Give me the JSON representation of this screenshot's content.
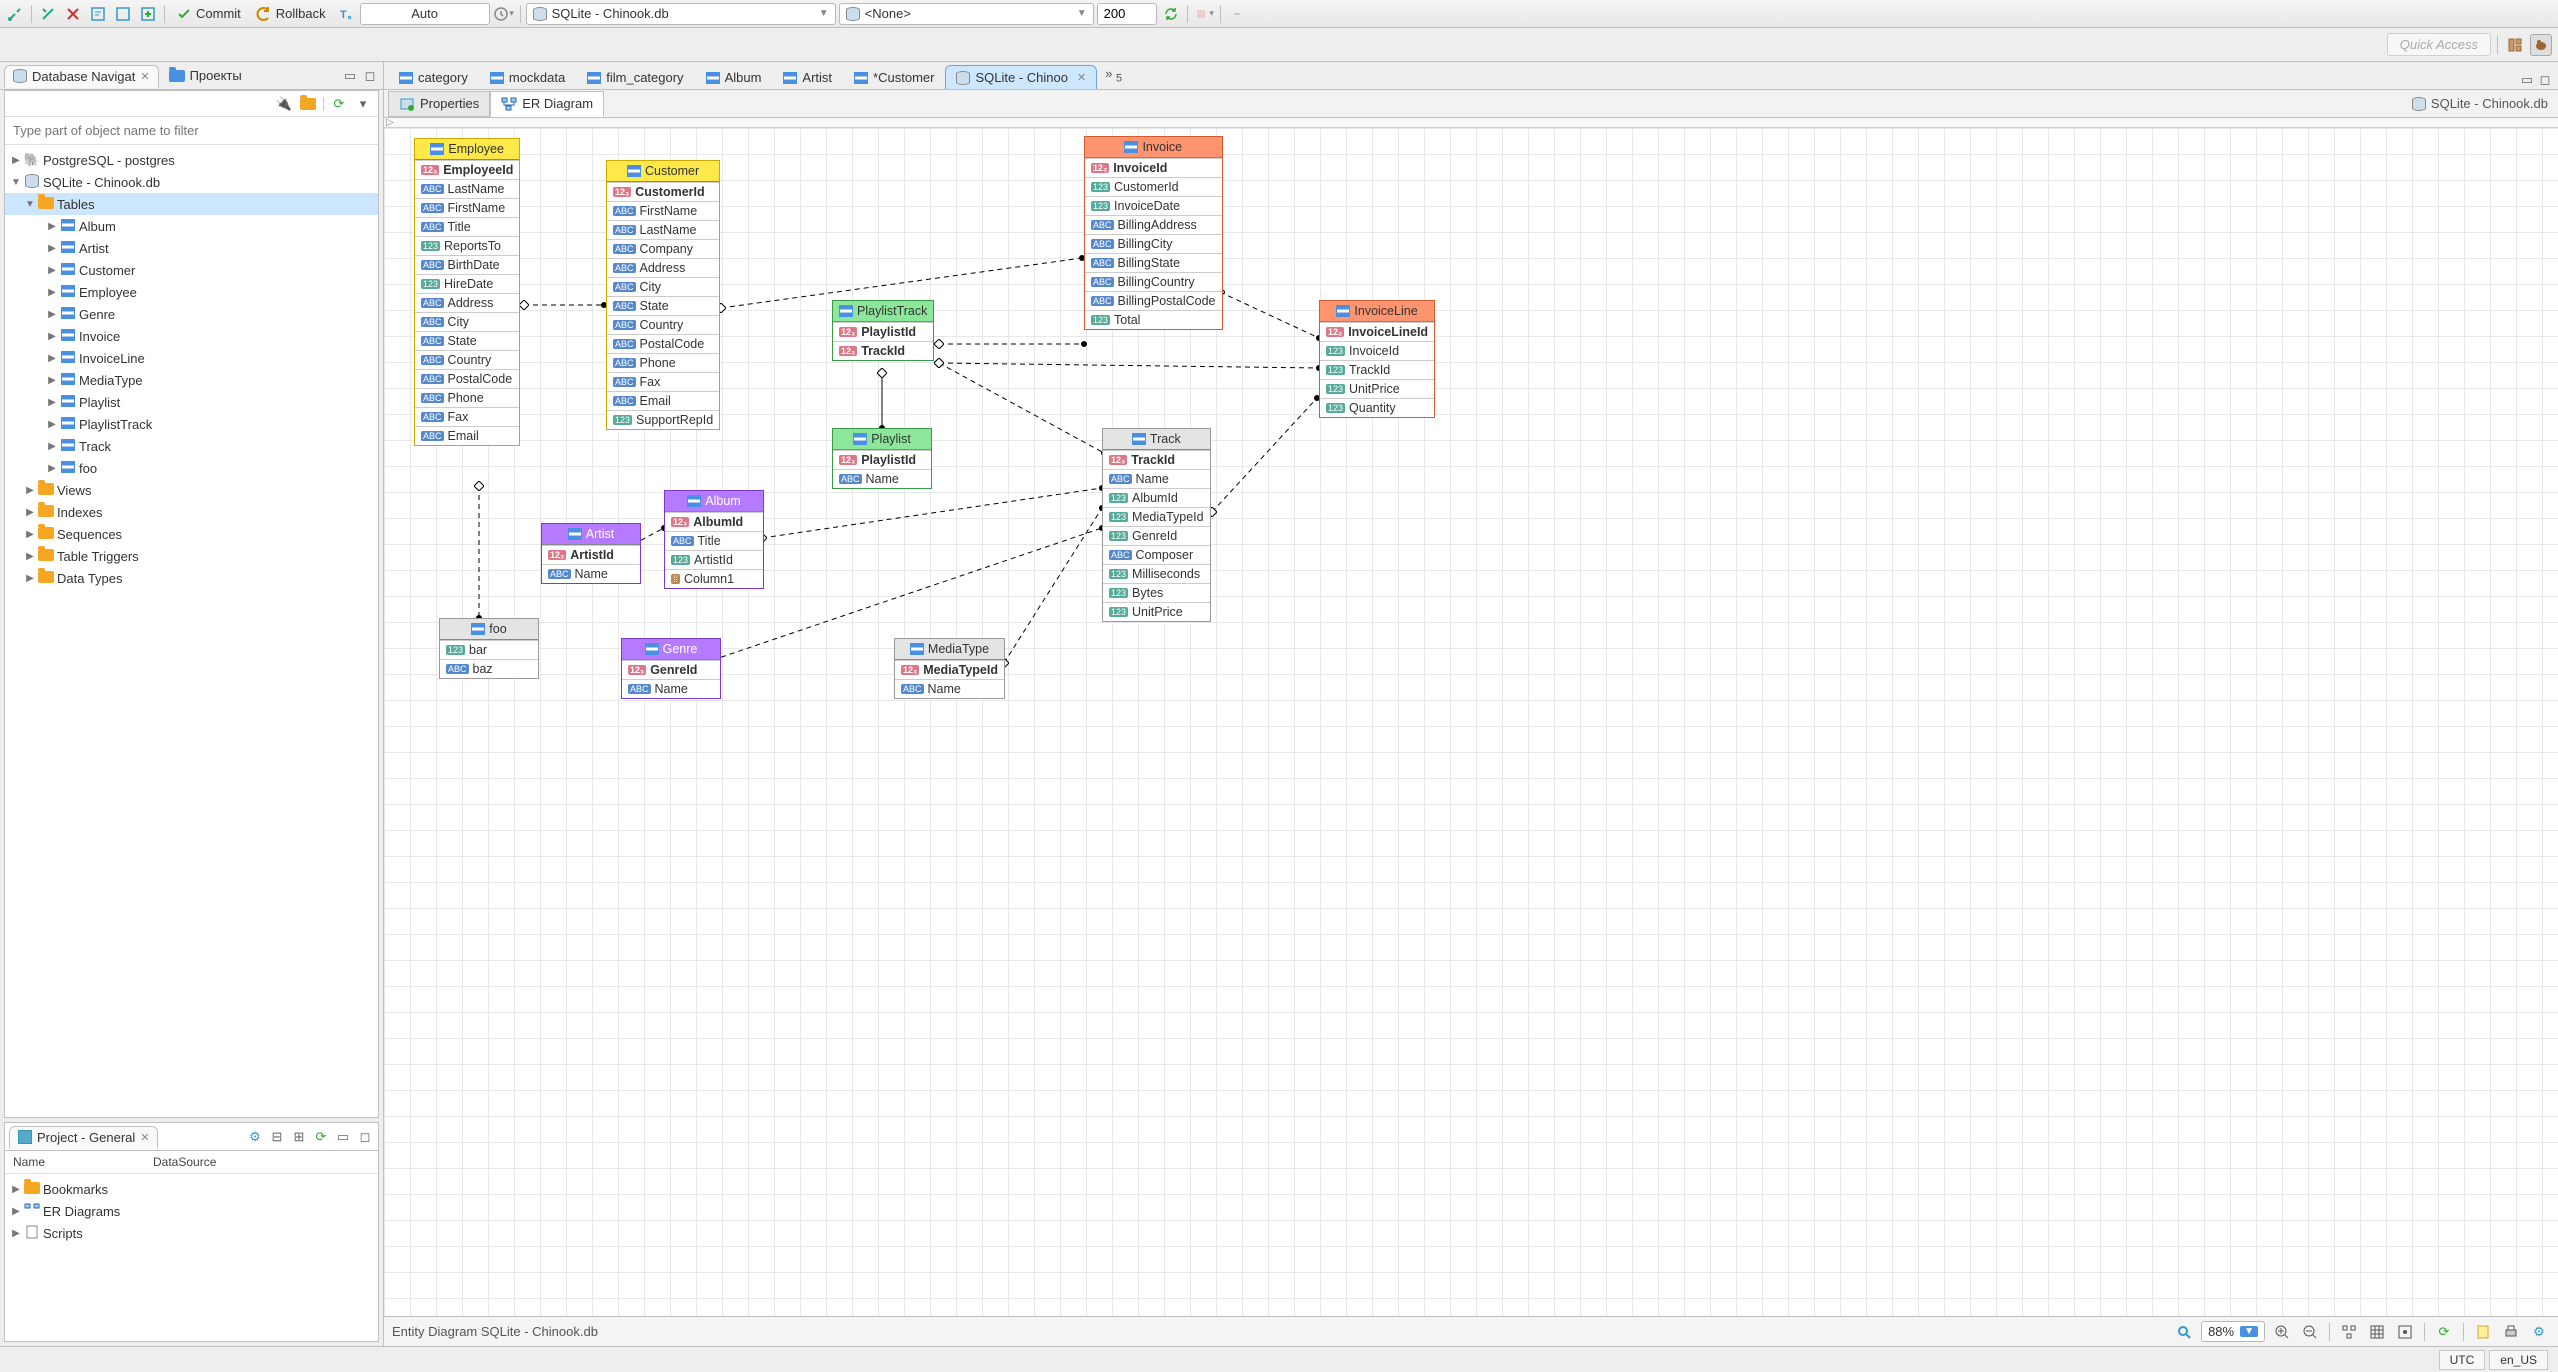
{
  "toolbar": {
    "commit": "Commit",
    "rollback": "Rollback",
    "tx_mode": "Auto",
    "active_db": "SQLite - Chinook.db",
    "active_schema": "<None>",
    "limit": "200"
  },
  "quick_access": "Quick Access",
  "nav_view": {
    "tab1": "Database Navigat",
    "tab2": "Проекты",
    "filter_placeholder": "Type part of object name to filter"
  },
  "nav_tree": {
    "postgres": "PostgreSQL - postgres",
    "sqlite": "SQLite - Chinook.db",
    "tables_label": "Tables",
    "tables": [
      "Album",
      "Artist",
      "Customer",
      "Employee",
      "Genre",
      "Invoice",
      "InvoiceLine",
      "MediaType",
      "Playlist",
      "PlaylistTrack",
      "Track",
      "foo"
    ],
    "views": "Views",
    "indexes": "Indexes",
    "sequences": "Sequences",
    "triggers": "Table Triggers",
    "datatypes": "Data Types"
  },
  "project_view": {
    "title": "Project - General",
    "col_name": "Name",
    "col_ds": "DataSource",
    "items": [
      "Bookmarks",
      "ER Diagrams",
      "Scripts"
    ]
  },
  "editor_tabs": [
    "category",
    "mockdata",
    "film_category",
    "Album",
    "Artist",
    "*Customer",
    "SQLite - Chinoo"
  ],
  "editor_tabs_overflow": "5",
  "subtabs": {
    "properties": "Properties",
    "er": "ER Diagram"
  },
  "breadcrumb": "SQLite - Chinook.db",
  "er": {
    "Employee": {
      "cols": [
        "EmployeeId",
        "LastName",
        "FirstName",
        "Title",
        "ReportsTo",
        "BirthDate",
        "HireDate",
        "Address",
        "City",
        "State",
        "Country",
        "PostalCode",
        "Phone",
        "Fax",
        "Email"
      ],
      "types": [
        "123",
        "ABC",
        "ABC",
        "ABC",
        "123",
        "ABC",
        "123",
        "ABC",
        "ABC",
        "ABC",
        "ABC",
        "ABC",
        "ABC",
        "ABC",
        "ABC"
      ],
      "pk": 0
    },
    "Customer": {
      "cols": [
        "CustomerId",
        "FirstName",
        "LastName",
        "Company",
        "Address",
        "City",
        "State",
        "Country",
        "PostalCode",
        "Phone",
        "Fax",
        "Email",
        "SupportRepId"
      ],
      "types": [
        "123",
        "ABC",
        "ABC",
        "ABC",
        "ABC",
        "ABC",
        "ABC",
        "ABC",
        "ABC",
        "ABC",
        "ABC",
        "ABC",
        "123"
      ],
      "pk": 0
    },
    "Invoice": {
      "cols": [
        "InvoiceId",
        "CustomerId",
        "InvoiceDate",
        "BillingAddress",
        "BillingCity",
        "BillingState",
        "BillingCountry",
        "BillingPostalCode",
        "Total"
      ],
      "types": [
        "123",
        "123",
        "123",
        "ABC",
        "ABC",
        "ABC",
        "ABC",
        "ABC",
        "123"
      ],
      "pk": 0
    },
    "InvoiceLine": {
      "cols": [
        "InvoiceLineId",
        "InvoiceId",
        "TrackId",
        "UnitPrice",
        "Quantity"
      ],
      "types": [
        "123",
        "123",
        "123",
        "123",
        "123"
      ],
      "pk": 0
    },
    "PlaylistTrack": {
      "cols": [
        "PlaylistId",
        "TrackId"
      ],
      "types": [
        "123",
        "123"
      ],
      "pk": -1
    },
    "Playlist": {
      "cols": [
        "PlaylistId",
        "Name"
      ],
      "types": [
        "123",
        "ABC"
      ],
      "pk": 0
    },
    "Track": {
      "cols": [
        "TrackId",
        "Name",
        "AlbumId",
        "MediaTypeId",
        "GenreId",
        "Composer",
        "Milliseconds",
        "Bytes",
        "UnitPrice"
      ],
      "types": [
        "123",
        "ABC",
        "123",
        "123",
        "123",
        "ABC",
        "123",
        "123",
        "123"
      ],
      "pk": 0
    },
    "Artist": {
      "cols": [
        "ArtistId",
        "Name"
      ],
      "types": [
        "123",
        "ABC"
      ],
      "pk": 0
    },
    "Album": {
      "cols": [
        "AlbumId",
        "Title",
        "ArtistId",
        "Column1"
      ],
      "types": [
        "123",
        "ABC",
        "123",
        "OBJ"
      ],
      "pk": 0
    },
    "Genre": {
      "cols": [
        "GenreId",
        "Name"
      ],
      "types": [
        "123",
        "ABC"
      ],
      "pk": 0
    },
    "MediaType": {
      "cols": [
        "MediaTypeId",
        "Name"
      ],
      "types": [
        "123",
        "ABC"
      ],
      "pk": 0
    },
    "foo": {
      "cols": [
        "bar",
        "baz"
      ],
      "types": [
        "123",
        "ABC"
      ],
      "pk": -1
    }
  },
  "er_footer": "Entity Diagram SQLite - Chinook.db",
  "zoom": "88%",
  "status": {
    "tz": "UTC",
    "locale": "en_US"
  }
}
